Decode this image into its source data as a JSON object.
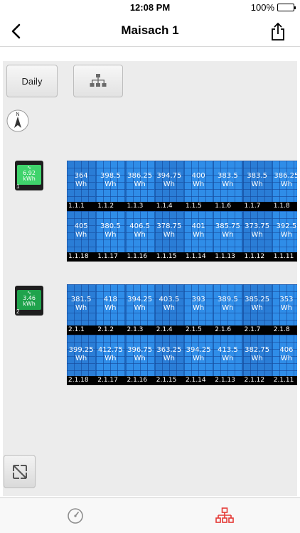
{
  "status": {
    "time": "12:08 PM",
    "battery": "100%"
  },
  "nav": {
    "title": "Maisach 1"
  },
  "toolbar": {
    "daily_label": "Daily"
  },
  "compass": {
    "letter": "N"
  },
  "inverters": [
    {
      "value": "6.92",
      "unit": "kWh",
      "number": "1"
    },
    {
      "value": "3.46",
      "unit": "kWh",
      "number": "2"
    }
  ],
  "arrays": [
    {
      "rows": [
        {
          "panels": [
            "364",
            "398.5",
            "386.25",
            "394.75",
            "400",
            "383.5",
            "383.5",
            "386.25"
          ],
          "labels": [
            "1.1.1",
            "1.1.2",
            "1.1.3",
            "1.1.4",
            "1.1.5",
            "1.1.6",
            "1.1.7",
            "1.1.8"
          ]
        },
        {
          "panels": [
            "405",
            "380.5",
            "406.5",
            "378.75",
            "401",
            "385.75",
            "373.75",
            "392.5"
          ],
          "labels": [
            "1.1.18",
            "1.1.17",
            "1.1.16",
            "1.1.15",
            "1.1.14",
            "1.1.13",
            "1.1.12",
            "1.1.11"
          ]
        }
      ]
    },
    {
      "rows": [
        {
          "panels": [
            "381.5",
            "418",
            "394.25",
            "403.5",
            "393",
            "389.5",
            "385.25",
            "353"
          ],
          "labels": [
            "2.1.1",
            "2.1.2",
            "2.1.3",
            "2.1.4",
            "2.1.5",
            "2.1.6",
            "2.1.7",
            "2.1.8"
          ]
        },
        {
          "panels": [
            "399.25",
            "412.75",
            "396.75",
            "363.25",
            "394.25",
            "413.5",
            "382.75",
            "406"
          ],
          "labels": [
            "2.1.18",
            "2.1.17",
            "2.1.16",
            "2.1.15",
            "2.1.14",
            "2.1.13",
            "2.1.12",
            "2.1.11"
          ]
        }
      ]
    }
  ],
  "panel_unit": "Wh",
  "colors": {
    "panel": "#2f8de8",
    "inverter_screen": "#3fd36b",
    "tab_active": "#e53935"
  },
  "icons": {
    "back": "chevron-left-icon",
    "share": "share-icon",
    "tree": "hierarchy-icon",
    "expand": "expand-icon",
    "dashboard": "gauge-icon",
    "plant": "hierarchy-icon"
  }
}
